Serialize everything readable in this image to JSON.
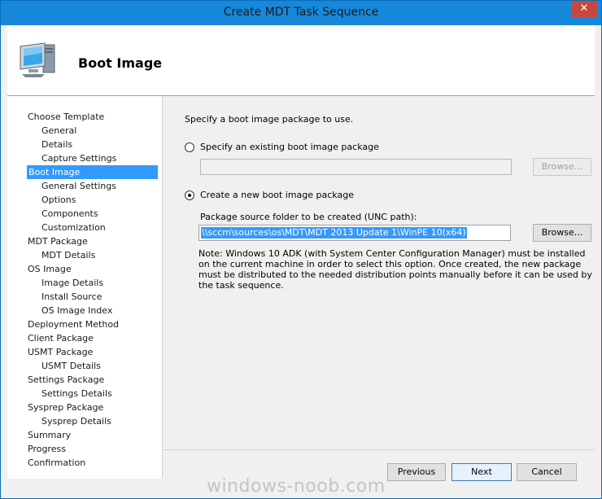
{
  "window": {
    "title": "Create MDT Task Sequence",
    "close_glyph": "✕"
  },
  "header": {
    "icon": "computer-icon",
    "title": "Boot Image"
  },
  "nav": {
    "items": [
      {
        "label": "Choose Template",
        "level": 0,
        "selected": false
      },
      {
        "label": "General",
        "level": 1,
        "selected": false
      },
      {
        "label": "Details",
        "level": 1,
        "selected": false
      },
      {
        "label": "Capture Settings",
        "level": 1,
        "selected": false
      },
      {
        "label": "Boot Image",
        "level": 0,
        "selected": true
      },
      {
        "label": "General Settings",
        "level": 1,
        "selected": false
      },
      {
        "label": "Options",
        "level": 1,
        "selected": false
      },
      {
        "label": "Components",
        "level": 1,
        "selected": false
      },
      {
        "label": "Customization",
        "level": 1,
        "selected": false
      },
      {
        "label": "MDT Package",
        "level": 0,
        "selected": false
      },
      {
        "label": "MDT Details",
        "level": 1,
        "selected": false
      },
      {
        "label": "OS Image",
        "level": 0,
        "selected": false
      },
      {
        "label": "Image Details",
        "level": 1,
        "selected": false
      },
      {
        "label": "Install Source",
        "level": 1,
        "selected": false
      },
      {
        "label": "OS Image Index",
        "level": 1,
        "selected": false
      },
      {
        "label": "Deployment Method",
        "level": 0,
        "selected": false
      },
      {
        "label": "Client Package",
        "level": 0,
        "selected": false
      },
      {
        "label": "USMT Package",
        "level": 0,
        "selected": false
      },
      {
        "label": "USMT Details",
        "level": 1,
        "selected": false
      },
      {
        "label": "Settings Package",
        "level": 0,
        "selected": false
      },
      {
        "label": "Settings Details",
        "level": 1,
        "selected": false
      },
      {
        "label": "Sysprep Package",
        "level": 0,
        "selected": false
      },
      {
        "label": "Sysprep Details",
        "level": 1,
        "selected": false
      },
      {
        "label": "Summary",
        "level": 0,
        "selected": false
      },
      {
        "label": "Progress",
        "level": 0,
        "selected": false
      },
      {
        "label": "Confirmation",
        "level": 0,
        "selected": false
      }
    ]
  },
  "main": {
    "instruction": "Specify a boot image package to use.",
    "option_existing": {
      "label": "Specify an existing boot image package",
      "checked": false,
      "value": ""
    },
    "option_new": {
      "label": "Create a new boot image package",
      "checked": true
    },
    "source_label": "Package source folder to be created (UNC path):",
    "source_value": "\\\\sccm\\sources\\os\\MDT\\MDT 2013 Update 1\\WinPE 10(x64)",
    "browse_label": "Browse...",
    "note": "Note: Windows 10 ADK (with System Center Configuration Manager) must be installed on the current machine in order to select this option.  Once created, the new package must be distributed to the needed distribution points manually before it can be used by the task sequence."
  },
  "footer": {
    "previous_label": "Previous",
    "next_label": "Next",
    "cancel_label": "Cancel"
  },
  "watermark": "windows-noob.com"
}
